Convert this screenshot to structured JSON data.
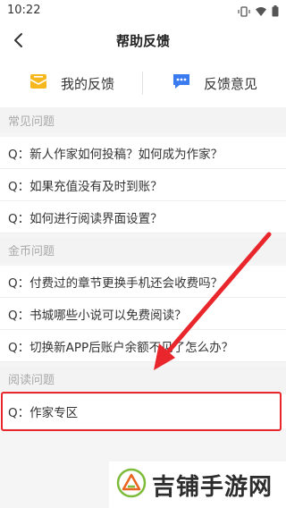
{
  "status_bar": {
    "time": "10:22"
  },
  "header": {
    "title": "帮助反馈",
    "back_icon": "chevron-left-icon"
  },
  "tabs": [
    {
      "label": "我的反馈",
      "icon": "mail-icon",
      "icon_color": "#f6b81c"
    },
    {
      "label": "反馈意见",
      "icon": "chat-icon",
      "icon_color": "#3a7bf0"
    }
  ],
  "sections": [
    {
      "title": "常见问题",
      "items": [
        "Q：新人作家如何投稿？如何成为作家？",
        "Q：如果充值没有及时到账？",
        "Q：如何进行阅读界面设置？"
      ]
    },
    {
      "title": "金币问题",
      "items": [
        "Q：付费过的章节更换手机还会收费吗？",
        "Q：书城哪些小说可以免费阅读？",
        "Q：切换新APP后账户余额不见了怎么办？"
      ]
    },
    {
      "title": "阅读问题",
      "items": [
        "Q：作家专区"
      ]
    }
  ],
  "annotation": {
    "color": "#e8262b"
  },
  "watermark": {
    "text": "吉铺手游网"
  }
}
